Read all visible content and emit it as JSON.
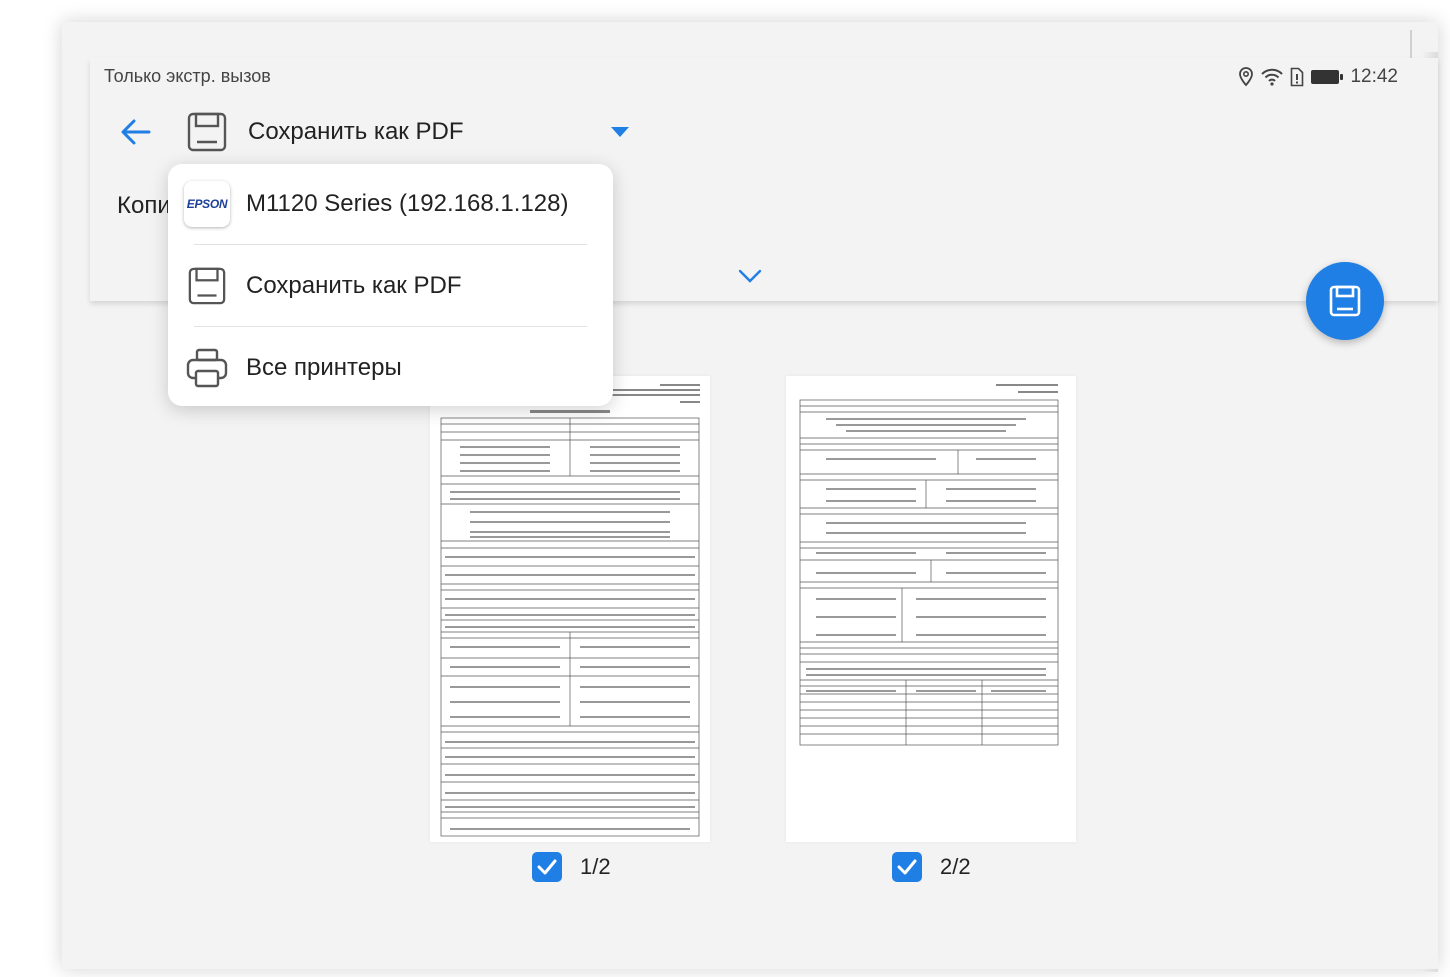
{
  "status_bar": {
    "left_text": "Только экстр. вызов",
    "time": "12:42",
    "icons": [
      "location-icon",
      "wifi-icon",
      "sim-icon",
      "battery-icon"
    ]
  },
  "header": {
    "selected_printer": "Сохранить как PDF",
    "copies_label": "Копи"
  },
  "dropdown": {
    "items": [
      {
        "label": "M1120 Series (192.168.1.128)",
        "icon": "epson-logo",
        "logo_text": "EPSON"
      },
      {
        "label": "Сохранить как PDF",
        "icon": "save-pdf-icon"
      },
      {
        "label": "Все принтеры",
        "icon": "printer-icon"
      }
    ]
  },
  "pages": [
    {
      "label": "1/2",
      "checked": true
    },
    {
      "label": "2/2",
      "checked": true
    }
  ],
  "colors": {
    "accent": "#1f7fe5",
    "background": "#f3f3f3"
  }
}
